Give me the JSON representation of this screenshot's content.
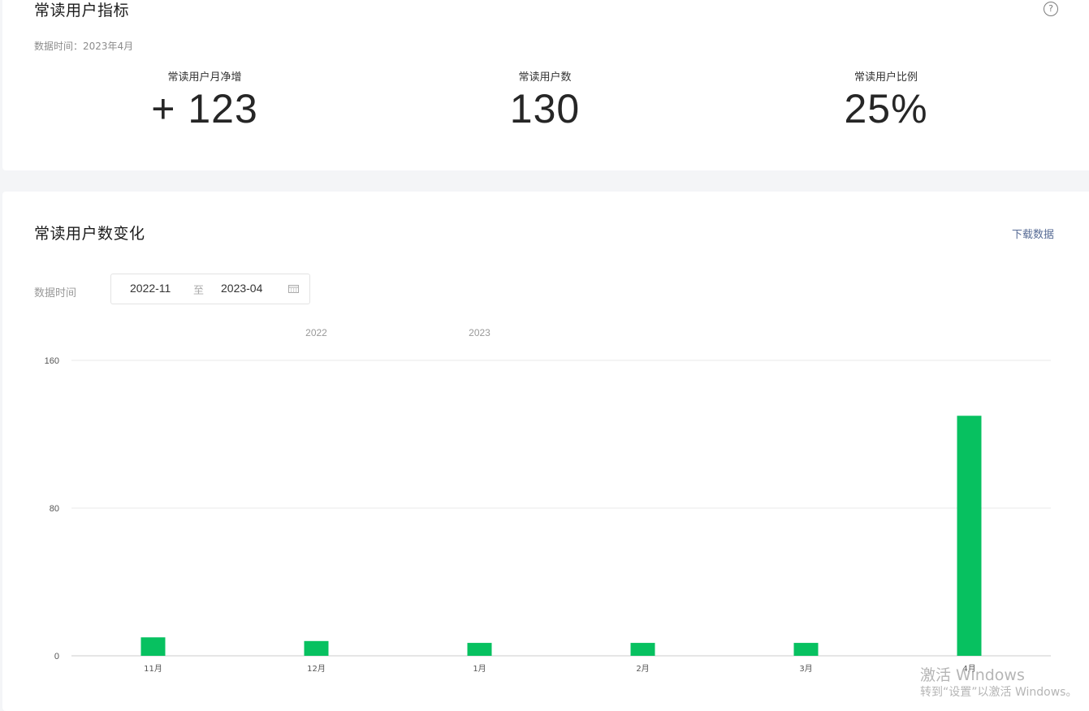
{
  "metrics_card": {
    "title": "常读用户指标",
    "help_icon": "question-circle-icon",
    "data_time": "数据时间：2023年4月",
    "metrics": [
      {
        "label": "常读用户月净增",
        "value": "+ 123"
      },
      {
        "label": "常读用户数",
        "value": "130"
      },
      {
        "label": "常读用户比例",
        "value": "25%"
      }
    ]
  },
  "trend_card": {
    "title": "常读用户数变化",
    "download_label": "下载数据",
    "filter": {
      "label": "数据时间",
      "start": "2022-11",
      "separator": "至",
      "end": "2023-04",
      "icon": "calendar-icon"
    }
  },
  "chart_data": {
    "type": "bar",
    "categories": [
      "11月",
      "12月",
      "1月",
      "2月",
      "3月",
      "4月"
    ],
    "year_markers": [
      {
        "label": "2022",
        "category": "12月"
      },
      {
        "label": "2023",
        "category": "1月"
      }
    ],
    "series": [
      {
        "values": [
          10,
          8,
          7,
          7,
          7,
          130
        ]
      }
    ],
    "ylim": [
      0,
      160
    ],
    "yticks": [
      0,
      80,
      160
    ],
    "grid": true,
    "bar_color": "#07c160",
    "gridline_color": "#e8e8e8",
    "axis_color": "#cccccc"
  },
  "watermark": {
    "title": "激活 Windows",
    "subtitle": "转到“设置”以激活 Windows。"
  },
  "colors": {
    "accent_link": "#576b95",
    "bar": "#07c160",
    "background": "#f4f5f7"
  }
}
